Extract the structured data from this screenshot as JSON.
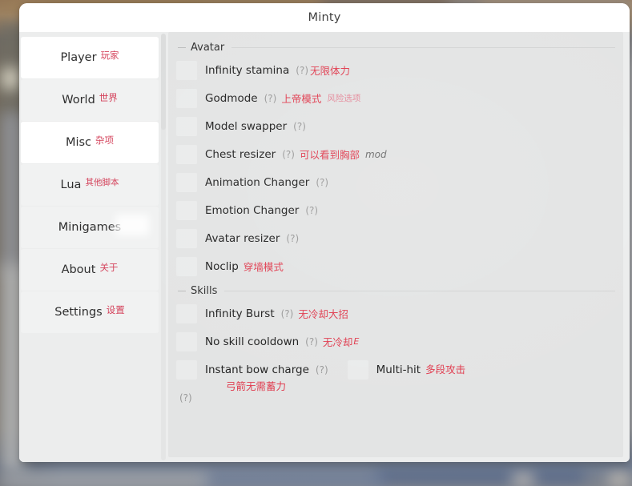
{
  "window": {
    "title": "Minty"
  },
  "sidebar": {
    "items": [
      {
        "label": "Player",
        "cn": "玩家",
        "active": true,
        "blur": false
      },
      {
        "label": "World",
        "cn": "世界",
        "active": false,
        "blur": false
      },
      {
        "label": "Misc",
        "cn": "杂项",
        "active": true,
        "blur": false
      },
      {
        "label": "Lua",
        "cn": "其他脚本",
        "active": false,
        "blur": false
      },
      {
        "label": "Minigames",
        "cn": "",
        "active": false,
        "blur": true
      },
      {
        "label": "About",
        "cn": "关于",
        "active": false,
        "blur": false
      },
      {
        "label": "Settings",
        "cn": "设置",
        "active": false,
        "blur": false
      }
    ]
  },
  "content": {
    "groups": [
      {
        "title": "Avatar",
        "rows": [
          {
            "label": "Infinity stamina",
            "qmark": "(?)",
            "cn": "无限体力",
            "cn2": "",
            "checked": false
          },
          {
            "label": "Godmode",
            "qmark": "(?)",
            "cn": "上帝模式",
            "cn2": "风险选项",
            "checked": false
          },
          {
            "label": "Model swapper",
            "qmark": "(?)",
            "cn": "",
            "cn2": "",
            "checked": false
          },
          {
            "label": "Chest resizer",
            "qmark": "(?)",
            "cn": "可以看到胸部",
            "cn2": "mod",
            "checked": false
          },
          {
            "label": "Animation Changer",
            "qmark": "(?)",
            "cn": "",
            "cn2": "",
            "checked": false
          },
          {
            "label": "Emotion Changer",
            "qmark": "(?)",
            "cn": "",
            "cn2": "",
            "checked": false
          },
          {
            "label": "Avatar resizer",
            "qmark": "(?)",
            "cn": "",
            "cn2": "",
            "checked": false
          },
          {
            "label": "Noclip",
            "qmark": "",
            "cn": "穿墙模式",
            "cn2": "",
            "checked": false
          }
        ]
      },
      {
        "title": "Skills",
        "rows": [
          {
            "label": "Infinity Burst",
            "qmark": "(?)",
            "cn": "无冷却大招",
            "cn2": "",
            "checked": false
          },
          {
            "label": "No skill cooldown",
            "qmark": "(?)",
            "cn": "无冷却",
            "cn2": "E",
            "checked": false
          }
        ],
        "double_row": {
          "first": {
            "label": "Instant bow charge",
            "qmark": "(?)",
            "checked": false
          },
          "second": {
            "label": "Multi-hit",
            "cn": "多段攻击",
            "checked": false
          },
          "sub_cn": "弓箭无需蓄力",
          "stray_qmark": "(?)"
        }
      }
    ]
  },
  "colors": {
    "accent_red": "#e03b4e",
    "panel_bg": "#e3e4e4",
    "sidebar_bg": "#eceded",
    "checkbox": "#eaebeb",
    "title_text": "#3b3b3b"
  }
}
